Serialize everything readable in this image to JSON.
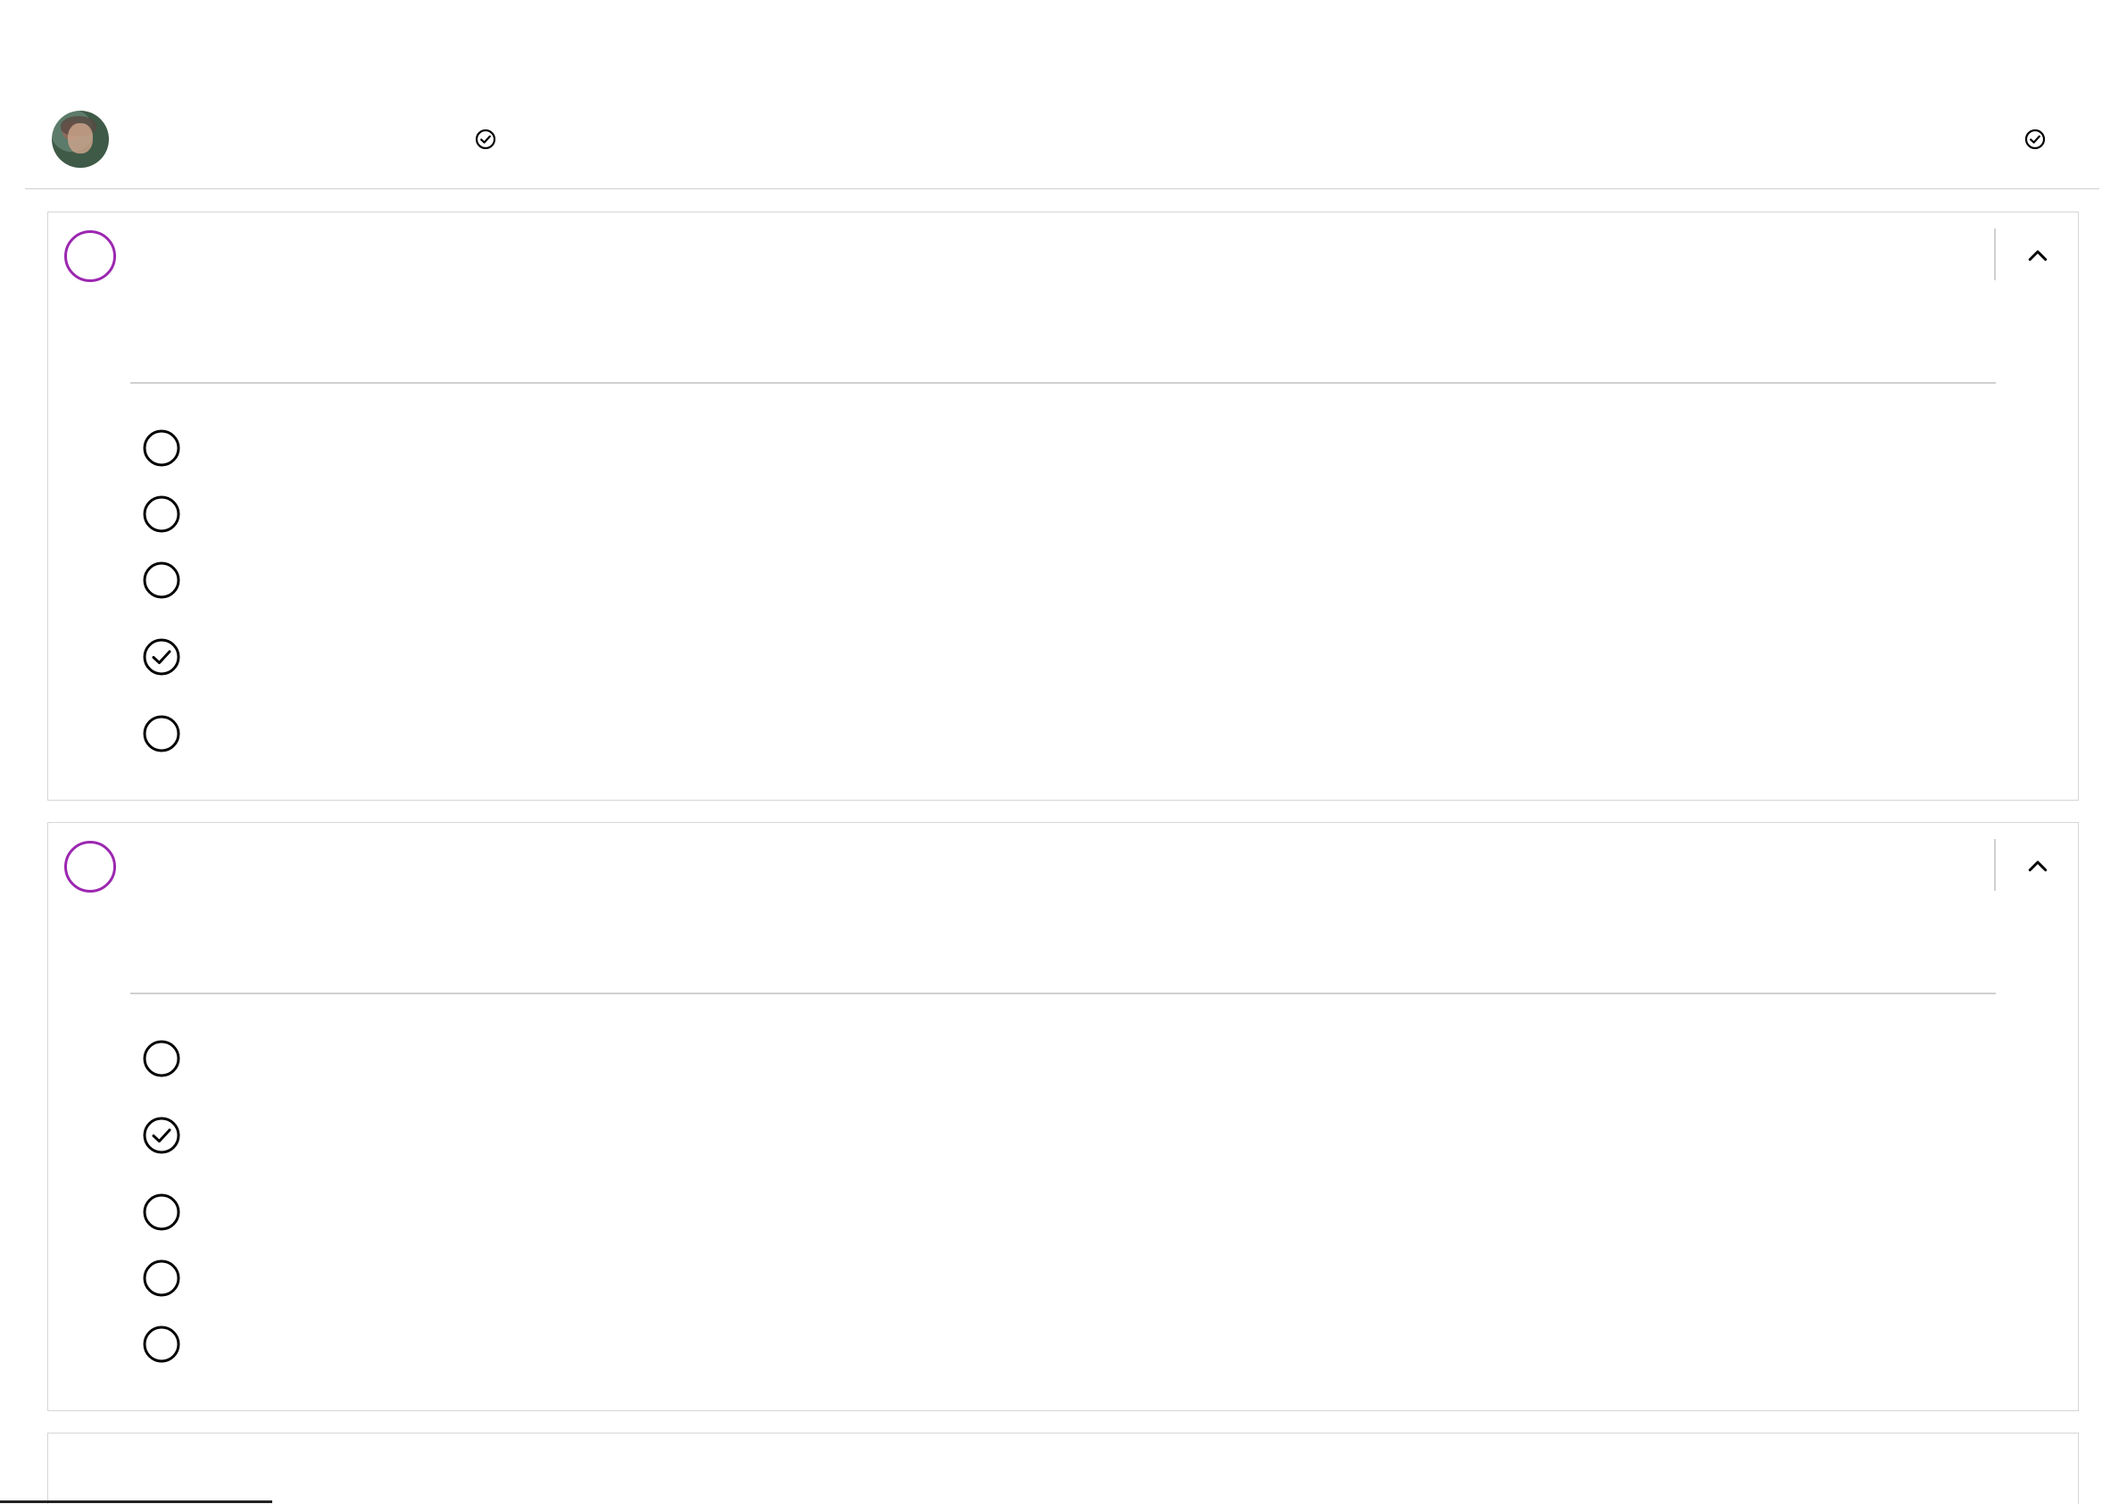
{
  "header": {
    "avatar_icon": "user-avatar",
    "title": "",
    "verified_icon": "check-circle-icon",
    "right_text": "",
    "right_icon": "check-circle-icon"
  },
  "questions": [
    {
      "number": "",
      "text": "",
      "collapse_icon": "chevron-up-icon",
      "options": [
        {
          "label": "",
          "selected": false
        },
        {
          "label": "",
          "selected": false
        },
        {
          "label": "",
          "selected": false
        },
        {
          "label": "",
          "selected": true
        },
        {
          "label": "",
          "selected": false
        }
      ]
    },
    {
      "number": "",
      "text": "",
      "collapse_icon": "chevron-up-icon",
      "options": [
        {
          "label": "",
          "selected": false
        },
        {
          "label": "",
          "selected": true
        },
        {
          "label": "",
          "selected": false
        },
        {
          "label": "",
          "selected": false
        },
        {
          "label": "",
          "selected": false
        }
      ]
    }
  ],
  "colors": {
    "accent": "#9c27b0",
    "border": "#d6d6d6",
    "text": "#222222"
  }
}
